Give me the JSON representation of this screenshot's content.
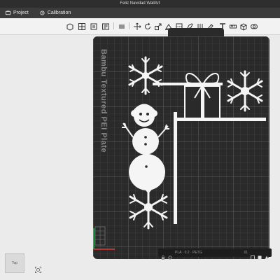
{
  "window": {
    "title": "Feliz Navidad WallArt"
  },
  "tabs": [
    {
      "label": "Project",
      "icon": "project-icon"
    },
    {
      "label": "Calibration",
      "icon": "calibration-icon"
    }
  ],
  "toolbar": {
    "tools": [
      "add-icon",
      "grid-icon",
      "orient-icon",
      "arrange-icon",
      "list-icon",
      "move-icon",
      "rotate-icon",
      "scale-icon",
      "lay-on-face-icon",
      "cut-icon",
      "support-paint-icon",
      "seam-paint-icon",
      "color-paint-icon",
      "text-icon",
      "measure-icon",
      "assembly-icon",
      "boolean-icon"
    ]
  },
  "plate": {
    "label": "Bambu Textured PEI Plate",
    "status_text": "PLA · 0.2 · PETG",
    "bottom_value": "01"
  },
  "viewcube": {
    "label": "Top"
  },
  "colors": {
    "titlebar": "#2e2e2e",
    "plate": "#2a2a2a",
    "model": "#f5f5f5",
    "accent": "#00ae42"
  }
}
